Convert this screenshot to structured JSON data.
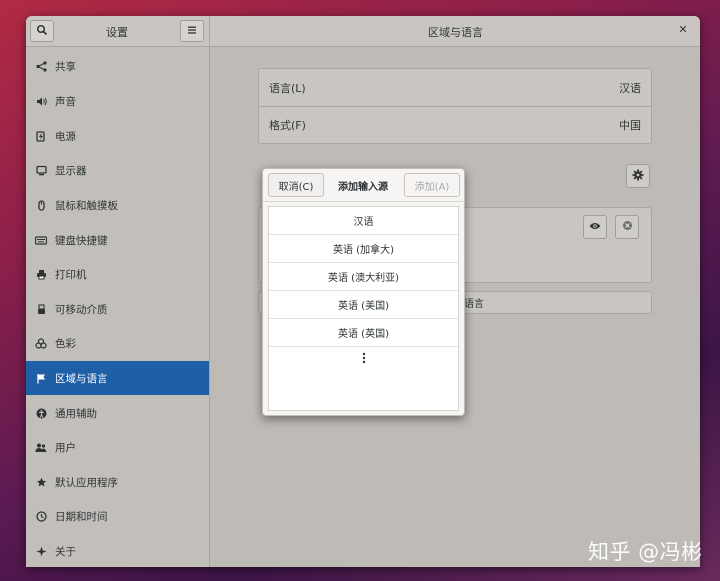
{
  "header": {
    "sidebar_title": "设置",
    "content_title": "区域与语言"
  },
  "sidebar": {
    "items": [
      {
        "label": "共享",
        "icon": "share-icon"
      },
      {
        "label": "声音",
        "icon": "speaker-icon"
      },
      {
        "label": "电源",
        "icon": "power-icon"
      },
      {
        "label": "显示器",
        "icon": "display-icon"
      },
      {
        "label": "鼠标和触摸板",
        "icon": "mouse-icon"
      },
      {
        "label": "键盘快捷键",
        "icon": "keyboard-icon"
      },
      {
        "label": "打印机",
        "icon": "printer-icon"
      },
      {
        "label": "可移动介质",
        "icon": "removable-media-icon"
      },
      {
        "label": "色彩",
        "icon": "color-icon"
      },
      {
        "label": "区域与语言",
        "icon": "flag-icon",
        "active": true
      },
      {
        "label": "通用辅助",
        "icon": "accessibility-icon"
      },
      {
        "label": "用户",
        "icon": "users-icon"
      },
      {
        "label": "默认应用程序",
        "icon": "star-icon"
      },
      {
        "label": "日期和时间",
        "icon": "clock-icon"
      },
      {
        "label": "关于",
        "icon": "sparkle-icon"
      }
    ]
  },
  "main": {
    "language_label": "语言(L)",
    "language_value": "汉语",
    "formats_label": "格式(F)",
    "formats_value": "中国",
    "bottom_button_partial": "的语言"
  },
  "dialog": {
    "cancel_label": "取消(C)",
    "title": "添加输入源",
    "add_label": "添加(A)",
    "items": [
      "汉语",
      "英语 (加拿大)",
      "英语 (澳大利亚)",
      "英语 (美国)",
      "英语 (英国)"
    ],
    "more_icon": "more-vertical-icon"
  },
  "watermark": {
    "text": "知乎 @冯彬"
  }
}
